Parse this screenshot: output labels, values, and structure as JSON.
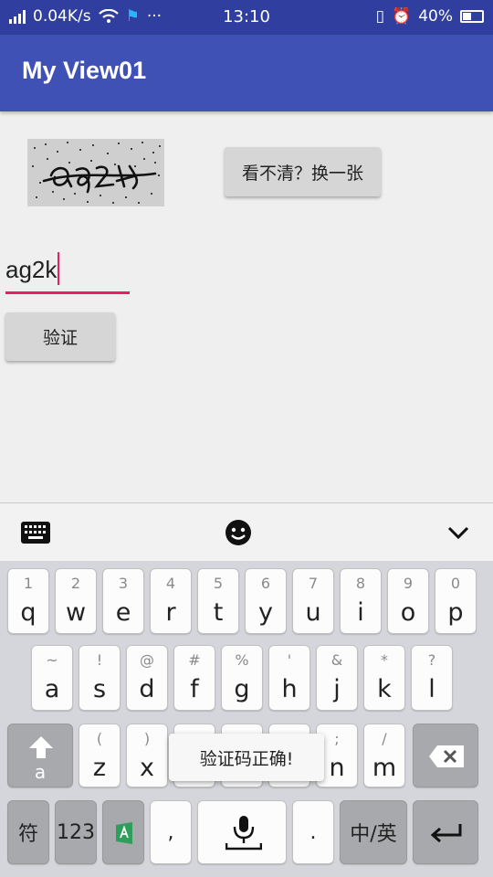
{
  "status_bar": {
    "net_speed": "0.04K/s",
    "time": "13:10",
    "battery": "40%",
    "dots": "···"
  },
  "app_bar": {
    "title": "My View01"
  },
  "captcha": {
    "text": "ag2k"
  },
  "buttons": {
    "refresh": "看不清？换一张",
    "verify": "验证"
  },
  "input": {
    "value": "ag2k"
  },
  "keyboard": {
    "row1": [
      {
        "sub": "1",
        "key": "q"
      },
      {
        "sub": "2",
        "key": "w"
      },
      {
        "sub": "3",
        "key": "e"
      },
      {
        "sub": "4",
        "key": "r"
      },
      {
        "sub": "5",
        "key": "t"
      },
      {
        "sub": "6",
        "key": "y"
      },
      {
        "sub": "7",
        "key": "u"
      },
      {
        "sub": "8",
        "key": "i"
      },
      {
        "sub": "9",
        "key": "o"
      },
      {
        "sub": "0",
        "key": "p"
      }
    ],
    "row2": [
      {
        "sub": "~",
        "key": "a"
      },
      {
        "sub": "!",
        "key": "s"
      },
      {
        "sub": "@",
        "key": "d"
      },
      {
        "sub": "#",
        "key": "f"
      },
      {
        "sub": "%",
        "key": "g"
      },
      {
        "sub": "'",
        "key": "h"
      },
      {
        "sub": "&",
        "key": "j"
      },
      {
        "sub": "*",
        "key": "k"
      },
      {
        "sub": "?",
        "key": "l"
      }
    ],
    "row3_left": [
      {
        "sub": "(",
        "key": "z"
      },
      {
        "sub": ")",
        "key": "x"
      }
    ],
    "row3_right": [
      {
        "sub": ";",
        "key": "n"
      },
      {
        "sub": "/",
        "key": "m"
      }
    ],
    "shift_sub": "a",
    "symbol_key": "符",
    "num_key": "123",
    "comma_key": ",",
    "period_key": ".",
    "lang_key": "中/英"
  },
  "toast": {
    "message": "验证码正确!"
  },
  "colors": {
    "primary": "#3f51b5",
    "primary_dark": "#303f9f",
    "accent": "#e91e63"
  }
}
